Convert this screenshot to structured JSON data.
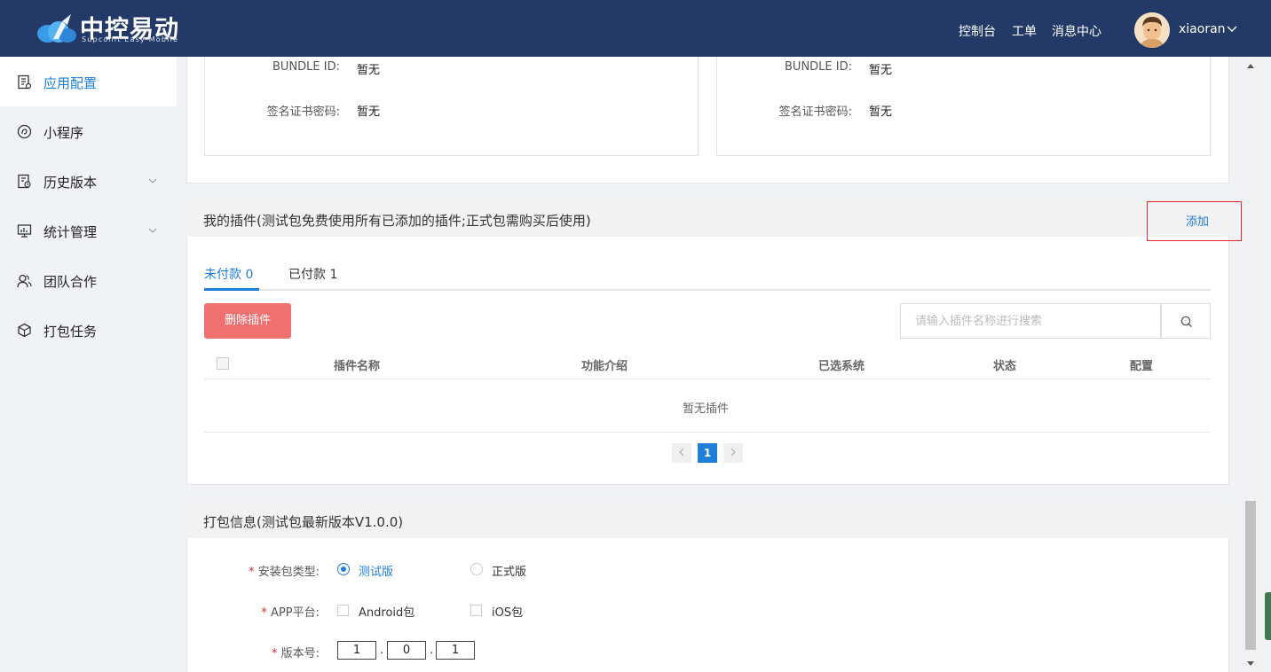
{
  "header": {
    "logo_title": "中控易动",
    "logo_subtitle": "Supconit Easy Mobile",
    "nav": [
      "控制台",
      "工单",
      "消息中心"
    ],
    "username": "xiaoran"
  },
  "sidebar": {
    "items": [
      {
        "label": "应用配置",
        "icon": "file-settings-icon",
        "active": true
      },
      {
        "label": "小程序",
        "icon": "compass-icon"
      },
      {
        "label": "历史版本",
        "icon": "history-file-icon",
        "expandable": true
      },
      {
        "label": "统计管理",
        "icon": "monitor-chart-icon",
        "expandable": true
      },
      {
        "label": "团队合作",
        "icon": "team-icon"
      },
      {
        "label": "打包任务",
        "icon": "package-icon"
      }
    ]
  },
  "cert_left": {
    "bundle_label": "BUNDLE ID:",
    "bundle_value": "暂无",
    "pwd_label": "签名证书密码:",
    "pwd_value": "暂无"
  },
  "cert_right": {
    "bundle_label": "BUNDLE ID:",
    "bundle_value": "暂无",
    "pwd_label": "签名证书密码:",
    "pwd_value": "暂无"
  },
  "plugins": {
    "title": "我的插件(测试包免费使用所有已添加的插件;正式包需购买后使用)",
    "add_label": "添加",
    "tabs": [
      {
        "label": "未付款 0",
        "active": true
      },
      {
        "label": "已付款 1",
        "active": false
      }
    ],
    "delete_label": "删除插件",
    "search_placeholder": "请输入插件名称进行搜索",
    "columns": [
      "插件名称",
      "功能介绍",
      "已选系统",
      "状态",
      "配置"
    ],
    "empty_text": "暂无插件",
    "pagination": {
      "current_page": "1"
    }
  },
  "build": {
    "title": "打包信息(测试包最新版本V1.0.0)",
    "required_mark": "*",
    "package_type_label": "安装包类型:",
    "package_types": [
      {
        "label": "测试版",
        "selected": true
      },
      {
        "label": "正式版",
        "selected": false
      }
    ],
    "platform_label": "APP平台:",
    "platforms": [
      {
        "label": "Android包",
        "checked": false
      },
      {
        "label": "iOS包",
        "checked": false
      }
    ],
    "version_label": "版本号:",
    "version": [
      "1",
      "0",
      "1"
    ]
  },
  "colors": {
    "header_bg": "#233a68",
    "accent": "#1e7ed8",
    "danger": "#f0706f",
    "highlight_box": "#e0282e"
  }
}
